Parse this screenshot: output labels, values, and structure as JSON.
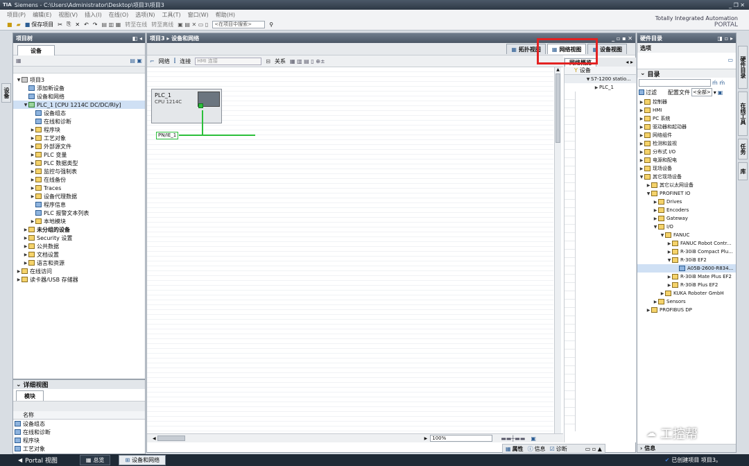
{
  "window": {
    "title": "Siemens  -  C:\\Users\\Administrator\\Desktop\\项目3\\项目3",
    "controls": "_ ❐ ✕"
  },
  "menu": [
    "项目(P)",
    "编辑(E)",
    "视图(V)",
    "插入(I)",
    "在线(O)",
    "选项(N)",
    "工具(T)",
    "窗口(W)",
    "帮助(H)"
  ],
  "toolbar": {
    "save_label": "保存项目",
    "go_online": "转至在线",
    "go_offline": "转至离线",
    "search_placeholder": "<在项目中搜索>"
  },
  "brand": {
    "line1": "Totally Integrated Automation",
    "line2": "PORTAL"
  },
  "project_tree": {
    "header": "项目树",
    "tab": "设备",
    "items": [
      {
        "label": "项目3",
        "level": 0,
        "expand": "▼",
        "icon": "gray"
      },
      {
        "label": "添加新设备",
        "level": 1,
        "expand": "",
        "icon": "blue"
      },
      {
        "label": "设备和网络",
        "level": 1,
        "expand": "",
        "icon": "blue"
      },
      {
        "label": "PLC_1 [CPU 1214C DC/DC/Rly]",
        "level": 1,
        "expand": "▼",
        "icon": "green",
        "selected": true
      },
      {
        "label": "设备组态",
        "level": 2,
        "expand": "",
        "icon": "blue"
      },
      {
        "label": "在线和诊断",
        "level": 2,
        "expand": "",
        "icon": "blue"
      },
      {
        "label": "程序块",
        "level": 2,
        "expand": "▶",
        "icon": "yellow"
      },
      {
        "label": "工艺对象",
        "level": 2,
        "expand": "▶",
        "icon": "yellow"
      },
      {
        "label": "外部源文件",
        "level": 2,
        "expand": "▶",
        "icon": "yellow"
      },
      {
        "label": "PLC 变量",
        "level": 2,
        "expand": "▶",
        "icon": "yellow"
      },
      {
        "label": "PLC 数据类型",
        "level": 2,
        "expand": "▶",
        "icon": "yellow"
      },
      {
        "label": "监控与强制表",
        "level": 2,
        "expand": "▶",
        "icon": "yellow"
      },
      {
        "label": "在线备份",
        "level": 2,
        "expand": "▶",
        "icon": "yellow"
      },
      {
        "label": "Traces",
        "level": 2,
        "expand": "▶",
        "icon": "yellow"
      },
      {
        "label": "设备代理数据",
        "level": 2,
        "expand": "▶",
        "icon": "yellow"
      },
      {
        "label": "程序信息",
        "level": 2,
        "expand": "",
        "icon": "blue"
      },
      {
        "label": "PLC 报警文本列表",
        "level": 2,
        "expand": "",
        "icon": "blue"
      },
      {
        "label": "本地模块",
        "level": 2,
        "expand": "▶",
        "icon": "yellow"
      },
      {
        "label": "未分组的设备",
        "level": 1,
        "expand": "▶",
        "icon": "yellow",
        "bold": true
      },
      {
        "label": "Security 设置",
        "level": 1,
        "expand": "▶",
        "icon": "yellow"
      },
      {
        "label": "公共数据",
        "level": 1,
        "expand": "▶",
        "icon": "yellow"
      },
      {
        "label": "文档设置",
        "level": 1,
        "expand": "▶",
        "icon": "yellow"
      },
      {
        "label": "语言和资源",
        "level": 1,
        "expand": "▶",
        "icon": "yellow"
      },
      {
        "label": "在线访问",
        "level": 0,
        "expand": "▶",
        "icon": "yellow"
      },
      {
        "label": "读卡器/USB 存储器",
        "level": 0,
        "expand": "▶",
        "icon": "yellow"
      }
    ],
    "side_tab": "设备"
  },
  "detail_view": {
    "header": "详细视图",
    "tab": "模块",
    "column": "名称",
    "rows": [
      "设备组态",
      "在线和诊断",
      "程序块",
      "工艺对象"
    ]
  },
  "editor": {
    "breadcrumb": "项目3 ▸ 设备和网络",
    "view_tabs": [
      "拓扑视图",
      "网络视图",
      "设备视图"
    ],
    "active_view": "网络视图",
    "toolbar": {
      "network": "网络",
      "connection": "连接",
      "hmi_conn": "HMI 连接",
      "relation": "关系"
    },
    "plc": {
      "name": "PLC_1",
      "cpu": "CPU 1214C"
    },
    "subnet": "PN/IE_1",
    "zoom": "100%"
  },
  "network_overview": {
    "tab": "网络概览",
    "col": "设备",
    "rows": [
      "S7-1200 statio...",
      "PLC_1"
    ]
  },
  "catalog": {
    "header": "硬件目录",
    "options": "选项",
    "dir": "目录",
    "filter": "过滤",
    "profile": "配置文件",
    "profile_value": "<全部>",
    "items": [
      {
        "label": "控制器",
        "level": 0,
        "expand": "▶"
      },
      {
        "label": "HMI",
        "level": 0,
        "expand": "▶"
      },
      {
        "label": "PC 系统",
        "level": 0,
        "expand": "▶"
      },
      {
        "label": "驱动器和起动器",
        "level": 0,
        "expand": "▶"
      },
      {
        "label": "网络组件",
        "level": 0,
        "expand": "▶"
      },
      {
        "label": "检测和监视",
        "level": 0,
        "expand": "▶"
      },
      {
        "label": "分布式 I/O",
        "level": 0,
        "expand": "▶"
      },
      {
        "label": "电源和配电",
        "level": 0,
        "expand": "▶"
      },
      {
        "label": "现场设备",
        "level": 0,
        "expand": "▶"
      },
      {
        "label": "其它现场设备",
        "level": 0,
        "expand": "▼"
      },
      {
        "label": "其它以太网设备",
        "level": 1,
        "expand": "▶"
      },
      {
        "label": "PROFINET IO",
        "level": 1,
        "expand": "▼"
      },
      {
        "label": "Drives",
        "level": 2,
        "expand": "▶"
      },
      {
        "label": "Encoders",
        "level": 2,
        "expand": "▶"
      },
      {
        "label": "Gateway",
        "level": 2,
        "expand": "▶"
      },
      {
        "label": "I/O",
        "level": 2,
        "expand": "▼"
      },
      {
        "label": "FANUC",
        "level": 3,
        "expand": "▼"
      },
      {
        "label": "FANUC Robot Contr...",
        "level": 4,
        "expand": "▶"
      },
      {
        "label": "R-30iB Compact Plu...",
        "level": 4,
        "expand": "▶"
      },
      {
        "label": "R-30iB EF2",
        "level": 4,
        "expand": "▼"
      },
      {
        "label": "A05B-2600-R834...",
        "level": 5,
        "expand": "",
        "selected": true
      },
      {
        "label": "R-30iB Mate Plus EF2",
        "level": 4,
        "expand": "▶"
      },
      {
        "label": "R-30iB Plus EF2",
        "level": 4,
        "expand": "▶"
      },
      {
        "label": "KUKA Roboter GmbH",
        "level": 3,
        "expand": "▶"
      },
      {
        "label": "Sensors",
        "level": 2,
        "expand": "▶"
      },
      {
        "label": "PROFIBUS DP",
        "level": 1,
        "expand": "▶"
      }
    ],
    "info": "信息"
  },
  "right_tabs": [
    "硬件目录",
    "在线工具",
    "任务",
    "库"
  ],
  "bottom": {
    "properties": "属性",
    "info": "信息",
    "diagnostics": "诊断"
  },
  "statusbar": {
    "portal": "Portal 视图",
    "overview": "总览",
    "tab": "设备和网络",
    "message": "已创建项目 项目3。"
  },
  "watermark": "工控帮"
}
